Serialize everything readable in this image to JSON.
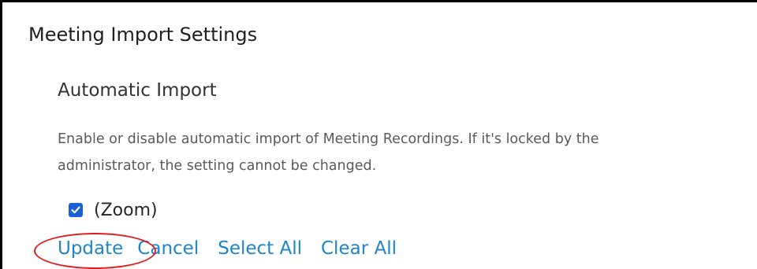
{
  "panel": {
    "title": "Meeting Import Settings"
  },
  "automatic_import": {
    "heading": "Automatic Import",
    "description_lines": [
      "Enable or disable automatic import of Meeting Recordings. If it's locked by the",
      "administrator, the setting cannot be changed."
    ],
    "option": {
      "label": "(Zoom)",
      "checked": true,
      "checkbox_color": "#1a5fd6"
    }
  },
  "actions": {
    "update_label": "Update",
    "cancel_label": "Cancel",
    "select_all_label": "Select All",
    "clear_all_label": "Clear All",
    "link_color": "#1e86c8"
  },
  "annotation": {
    "highlight_color": "#e01b1b",
    "highlighted_item": "update"
  }
}
